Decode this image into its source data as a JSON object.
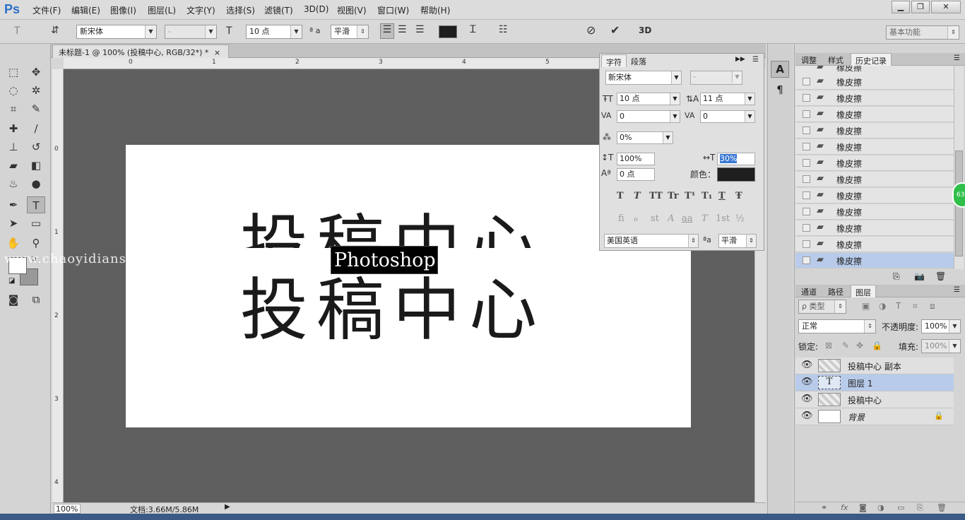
{
  "app": {
    "logo": "Ps"
  },
  "menu": [
    "文件(F)",
    "编辑(E)",
    "图像(I)",
    "图层(L)",
    "文字(Y)",
    "选择(S)",
    "滤镜(T)",
    "3D(D)",
    "视图(V)",
    "窗口(W)",
    "帮助(H)"
  ],
  "window_controls": {
    "minimize": "▁",
    "restore": "❐",
    "close": "✕"
  },
  "options_bar": {
    "font_family": "新宋体",
    "font_style": "-",
    "font_size": "10 点",
    "aa_label": "ª a",
    "antialias": "平滑",
    "three_d": "3D",
    "workspace": "基本功能"
  },
  "document": {
    "tab_title": "未标题-1 @ 100% (投稿中心, RGB/32*) *",
    "tab_close": "×",
    "text_large": "投稿中心",
    "text_selected": "Photoshop",
    "watermark": "www.chaoyidians",
    "ruler_top": [
      "0",
      "1",
      "2",
      "3",
      "4",
      "5"
    ],
    "ruler_left": [
      "0",
      "1",
      "2",
      "3",
      "4"
    ]
  },
  "status": {
    "zoom": "100%",
    "doc_info": "文档:3.66M/5.86M"
  },
  "char_panel": {
    "tabs": [
      "字符",
      "段落"
    ],
    "font_family": "新宋体",
    "font_style": "-",
    "font_size": "10 点",
    "leading": "11 点",
    "kerning": "0",
    "tracking": "0",
    "tsume": "0%",
    "vscale": "100%",
    "hscale": "30%",
    "baseline": "0 点",
    "color_label": "颜色：",
    "color": "#1e1e1e",
    "style_buttons": [
      "T",
      "T",
      "TT",
      "Tr",
      "T¹",
      "T₁",
      "T",
      "Ŧ"
    ],
    "ot_buttons": [
      "fi",
      "ℴ",
      "st",
      "A",
      "aa",
      "T",
      "1st",
      "½"
    ],
    "language": "美国英语",
    "aa_label": "ªa",
    "antialias": "平滑"
  },
  "history_panel": {
    "tabs": [
      "调整",
      "样式",
      "历史记录"
    ],
    "items": [
      "橡皮擦",
      "橡皮擦",
      "橡皮擦",
      "橡皮擦",
      "橡皮擦",
      "橡皮擦",
      "橡皮擦",
      "橡皮擦",
      "橡皮擦",
      "橡皮擦",
      "橡皮擦",
      "橡皮擦"
    ]
  },
  "layers_panel": {
    "tabs": [
      "通道",
      "路径",
      "图层"
    ],
    "filter_label": "ρ 类型",
    "blend_mode": "正常",
    "opacity_label": "不透明度:",
    "opacity": "100%",
    "lock_label": "锁定:",
    "fill_label": "填充:",
    "fill": "100%",
    "layers": [
      {
        "name": "投稿中心 副本",
        "type": "raster"
      },
      {
        "name": "图层 1",
        "type": "text"
      },
      {
        "name": "投稿中心",
        "type": "raster"
      },
      {
        "name": "背景",
        "type": "background"
      }
    ]
  },
  "badge": "63"
}
